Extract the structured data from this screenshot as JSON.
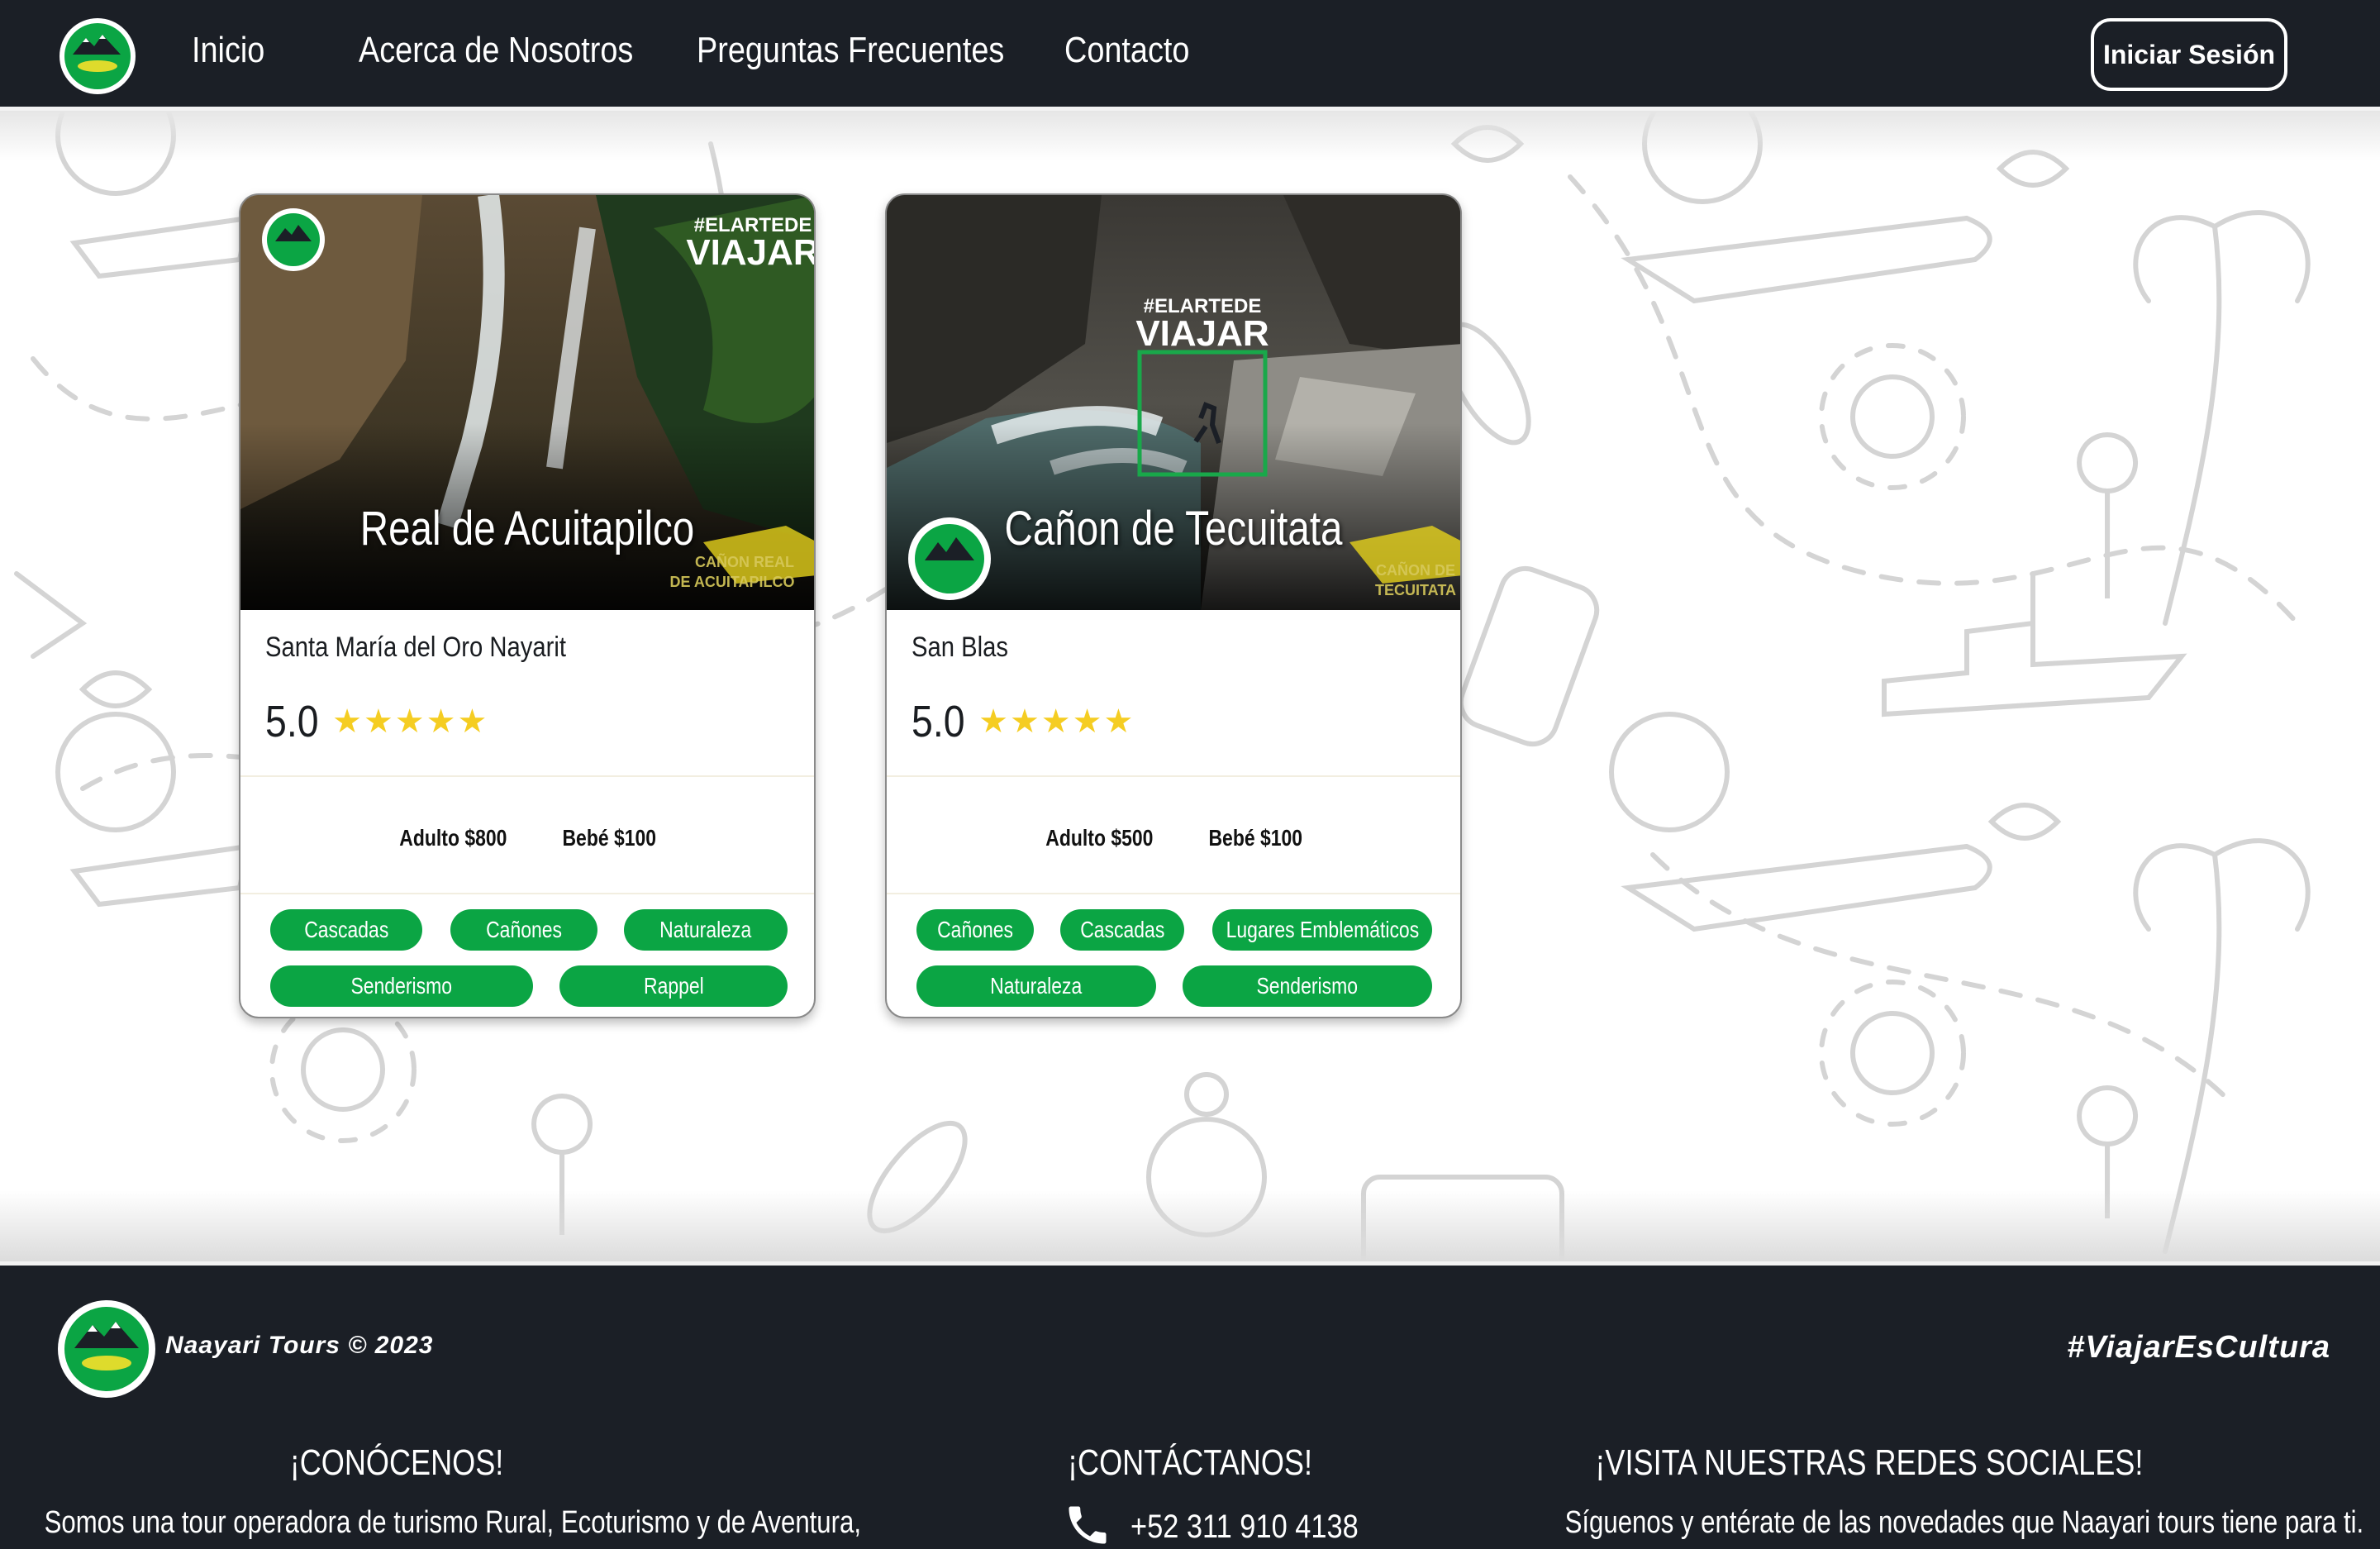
{
  "navbar": {
    "logo_label": "Naayari tours",
    "links": [
      "Inicio",
      "Acerca de Nosotros",
      "Preguntas Frecuentes",
      "Contacto"
    ],
    "login_label": "Iniciar Sesión"
  },
  "tours": [
    {
      "title": "Real de Acuitapilco",
      "location": "Santa María del Oro Nayarit",
      "rating": "5.0",
      "stars": 5,
      "prices": [
        "Adulto $800",
        "Bebé $100"
      ],
      "tags": [
        "Cascadas",
        "Cañones",
        "Naturaleza",
        "Senderismo",
        "Rappel"
      ],
      "image_hashtag_top": "#ELARTEDE",
      "image_hashtag_bottom": "VIAJAR",
      "image_caption_top": "CAÑON REAL",
      "image_caption_bottom": "DE ACUITAPILCO"
    },
    {
      "title": "Cañon de Tecuitata",
      "location": "San Blas",
      "rating": "5.0",
      "stars": 5,
      "prices": [
        "Adulto $500",
        "Bebé $100"
      ],
      "tags": [
        "Cañones",
        "Cascadas",
        "Lugares Emblemáticos",
        "Naturaleza",
        "Senderismo"
      ],
      "image_hashtag_top": "#ELARTEDE",
      "image_hashtag_bottom": "VIAJAR",
      "image_caption_top": "CAÑON DE",
      "image_caption_bottom": "TECUITATA"
    }
  ],
  "footer": {
    "brand": "Naayari Tours © 2023",
    "hashtag": "#ViajarEsCultura",
    "about_heading": "¡CONÓCENOS!",
    "about_text": "Somos una tour operadora de turismo Rural, Ecoturismo y de Aventura,",
    "contact_heading": "¡CONTÁCTANOS!",
    "phone": "+52 311 910 4138",
    "social_heading": "¡VISITA NUESTRAS REDES SOCIALES!",
    "social_text": "Síguenos y entérate de las novedades que Naayari tours tiene para ti."
  },
  "colors": {
    "dark": "#1b1f26",
    "green": "#0ba544",
    "star": "#f5cd22"
  }
}
